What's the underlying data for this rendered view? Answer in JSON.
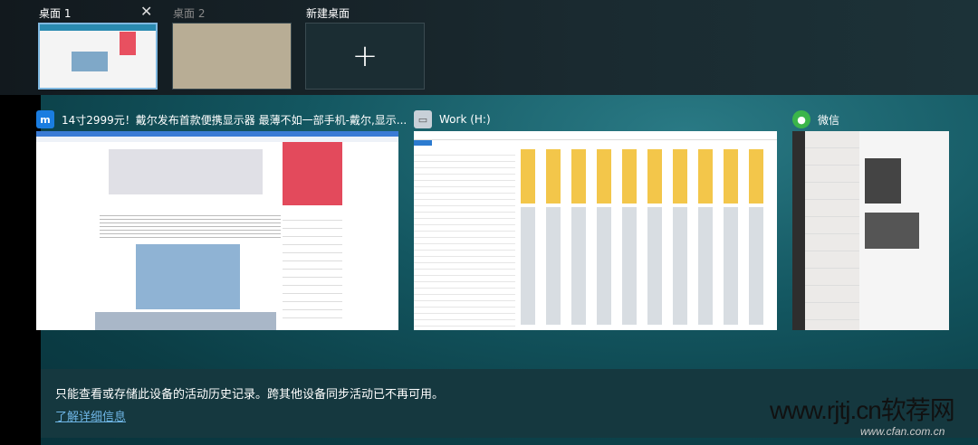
{
  "desktops": [
    {
      "label": "桌面 1",
      "selected": true
    },
    {
      "label": "桌面 2",
      "selected": false
    }
  ],
  "new_desktop_label": "新建桌面",
  "close_symbol": "✕",
  "plus_symbol": "+",
  "windows": [
    {
      "title": "14寸2999元！戴尔发布首款便携显示器 最薄不如一部手机-戴尔,显示...",
      "icon": "maxthon-browser-icon"
    },
    {
      "title": "Work (H:)",
      "icon": "drive-icon"
    },
    {
      "title": "微信",
      "icon": "wechat-icon"
    }
  ],
  "notice": {
    "message": "只能查看或存储此设备的活动历史记录。跨其他设备同步活动已不再可用。",
    "link": "了解详细信息"
  },
  "watermarks": {
    "main": "www.rjtj.cn软荐网",
    "sub": "www.cfan.com.cn"
  }
}
